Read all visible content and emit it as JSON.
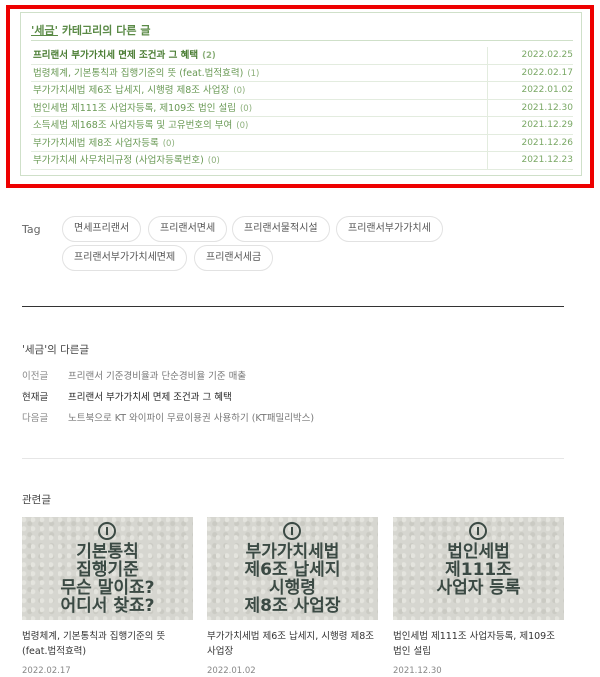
{
  "category_box": {
    "title_quote": "'세금'",
    "title_rest": " 카테고리의 다른 글",
    "posts": [
      {
        "title": "프리랜서 부가가치세 면제 조건과 그 혜택",
        "count": "(2)",
        "date": "2022.02.25",
        "current": true
      },
      {
        "title": "법령체계, 기본통칙과 집행기준의 뜻 (feat.법적효력)",
        "count": "(1)",
        "date": "2022.02.17"
      },
      {
        "title": "부가가치세법 제6조 납세지, 시행령 제8조 사업장",
        "count": "(0)",
        "date": "2022.01.02"
      },
      {
        "title": "법인세법 제111조 사업자등록, 제109조 법인 설립",
        "count": "(0)",
        "date": "2021.12.30"
      },
      {
        "title": "소득세법 제168조 사업자등록 및 고유번호의 부여",
        "count": "(0)",
        "date": "2021.12.29"
      },
      {
        "title": "부가가치세법 제8조 사업자등록",
        "count": "(0)",
        "date": "2021.12.26"
      },
      {
        "title": "부가가치세 사무처리규정 (사업자등록번호)",
        "count": "(0)",
        "date": "2021.12.23"
      }
    ]
  },
  "tags": {
    "label": "Tag",
    "items": [
      "면세프리랜서",
      "프리랜서면세",
      "프리랜서물적시설",
      "프리랜서부가가치세",
      "프리랜서부가가치세면제",
      "프리랜서세금"
    ]
  },
  "other_posts": {
    "heading": "'세금'의 다른글",
    "prev_label": "이전글",
    "prev_title": "프리랜서 기준경비율과 단순경비율 기준 매출",
    "current_label": "현재글",
    "current_title": "프리랜서 부가가치세 면제 조건과 그 혜택",
    "next_label": "다음글",
    "next_title": "노트북으로 KT 와이파이 무료이용권 사용하기 (KT패밀리박스)"
  },
  "related": {
    "heading": "관련글",
    "cards": [
      {
        "thumb_text": "기본통칙\n집행기준\n무슨 말이죠?\n어디서 찾죠?",
        "title": "법령체계, 기본통칙과 집행기준의 뜻 (feat.법적효력)",
        "date": "2022.02.17"
      },
      {
        "thumb_text": "부가가치세법\n제6조 납세지\n시행령\n제8조 사업장",
        "title": "부가가치세법 제6조 납세지, 시행령 제8조 사업장",
        "date": "2022.01.02"
      },
      {
        "thumb_text": "법인세법\n제111조\n사업자 등록",
        "title": "법인세법 제111조 사업자등록, 제109조 법인 설립",
        "date": "2021.12.30"
      }
    ]
  }
}
